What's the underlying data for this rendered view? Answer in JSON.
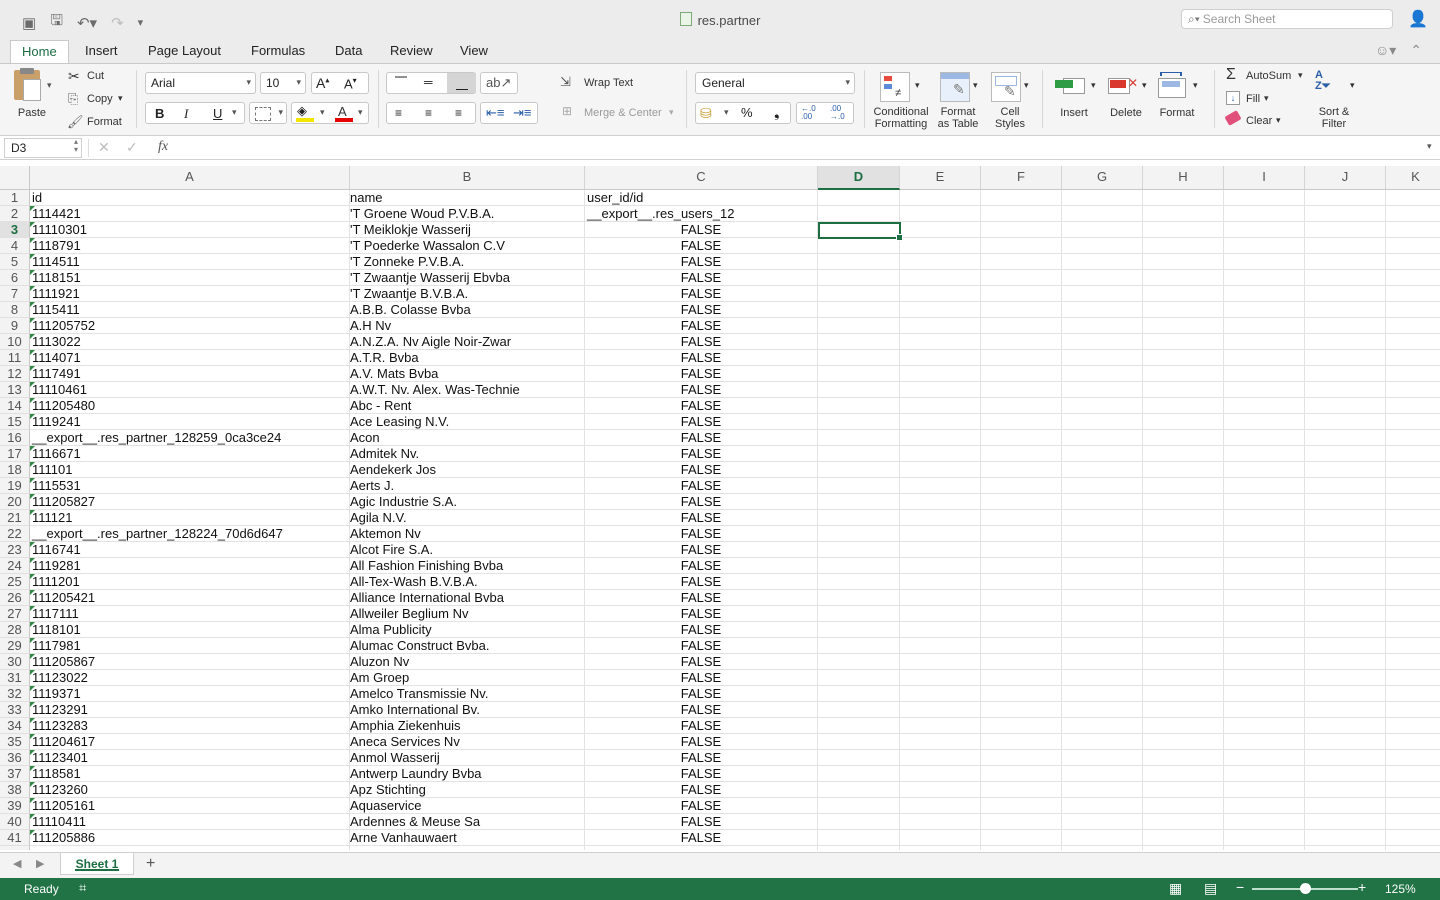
{
  "window": {
    "title": "res.partner",
    "search_placeholder": "Search Sheet"
  },
  "tabs": [
    "Home",
    "Insert",
    "Page Layout",
    "Formulas",
    "Data",
    "Review",
    "View"
  ],
  "ribbon": {
    "paste": "Paste",
    "cut": "Cut",
    "copy": "Copy",
    "format_painter": "Format",
    "font_name": "Arial",
    "font_size": "10",
    "bold": "B",
    "italic": "I",
    "underline": "U",
    "wrap_text": "Wrap Text",
    "merge_center": "Merge & Center",
    "number_format": "General",
    "percent": "%",
    "conditional_formatting": "Conditional\nFormatting",
    "format_as_table": "Format\nas Table",
    "cell_styles": "Cell\nStyles",
    "insert": "Insert",
    "delete": "Delete",
    "format": "Format",
    "autosum": "AutoSum",
    "fill": "Fill",
    "clear": "Clear",
    "sort_filter": "Sort &\nFilter"
  },
  "formula_bar": {
    "name_box": "D3",
    "fx": "fx",
    "formula": ""
  },
  "columns": [
    "A",
    "B",
    "C",
    "D",
    "E",
    "F",
    "G",
    "H",
    "I",
    "J",
    "K"
  ],
  "selected_cell": "D3",
  "rows": [
    {
      "n": "1",
      "a": "id",
      "b": "name",
      "c": "user_id/id",
      "c_left": true,
      "a_num": false
    },
    {
      "n": "2",
      "a": "1114421",
      "b": "'T Groene Woud P.V.B.A.",
      "c": "__export__.res_users_12",
      "c_left": true,
      "a_num": true
    },
    {
      "n": "3",
      "a": "11110301",
      "b": "'T Meiklokje   Wasserij",
      "c": "FALSE",
      "a_num": true
    },
    {
      "n": "4",
      "a": "1118791",
      "b": "'T Poederke   Wassalon C.V",
      "c": "FALSE",
      "a_num": true
    },
    {
      "n": "5",
      "a": "1114511",
      "b": "'T Zonneke P.V.B.A.",
      "c": "FALSE",
      "a_num": true
    },
    {
      "n": "6",
      "a": "1118151",
      "b": "'T Zwaantje  Wasserij  Ebvba",
      "c": "FALSE",
      "a_num": true
    },
    {
      "n": "7",
      "a": "1111921",
      "b": "'T Zwaantje B.V.B.A.",
      "c": "FALSE",
      "a_num": true
    },
    {
      "n": "8",
      "a": "1115411",
      "b": "A.B.B. Colasse Bvba",
      "c": "FALSE",
      "a_num": true
    },
    {
      "n": "9",
      "a": "111205752",
      "b": "A.H Nv",
      "c": "FALSE",
      "a_num": true
    },
    {
      "n": "10",
      "a": "1113022",
      "b": "A.N.Z.A. Nv  Aigle Noir-Zwar",
      "c": "FALSE",
      "a_num": true
    },
    {
      "n": "11",
      "a": "1114071",
      "b": "A.T.R.  Bvba",
      "c": "FALSE",
      "a_num": true
    },
    {
      "n": "12",
      "a": "1117491",
      "b": "A.V. Mats Bvba",
      "c": "FALSE",
      "a_num": true
    },
    {
      "n": "13",
      "a": "11110461",
      "b": "A.W.T. Nv. Alex. Was-Technie",
      "c": "FALSE",
      "a_num": true
    },
    {
      "n": "14",
      "a": "111205480",
      "b": "Abc - Rent",
      "c": "FALSE",
      "a_num": true
    },
    {
      "n": "15",
      "a": "1119241",
      "b": "Ace Leasing N.V.",
      "c": "FALSE",
      "a_num": true
    },
    {
      "n": "16",
      "a": "__export__.res_partner_128259_0ca3ce24",
      "b": "Acon",
      "c": "FALSE",
      "a_num": false
    },
    {
      "n": "17",
      "a": "1116671",
      "b": "Admitek  Nv.",
      "c": "FALSE",
      "a_num": true
    },
    {
      "n": "18",
      "a": "111101",
      "b": "Aendekerk Jos",
      "c": "FALSE",
      "a_num": true
    },
    {
      "n": "19",
      "a": "1115531",
      "b": "Aerts  J.",
      "c": "FALSE",
      "a_num": true
    },
    {
      "n": "20",
      "a": "111205827",
      "b": "Agic Industrie S.A.",
      "c": "FALSE",
      "a_num": true
    },
    {
      "n": "21",
      "a": "111121",
      "b": "Agila  N.V.",
      "c": "FALSE",
      "a_num": true
    },
    {
      "n": "22",
      "a": "__export__.res_partner_128224_70d6d647",
      "b": "Aktemon Nv",
      "c": "FALSE",
      "a_num": false
    },
    {
      "n": "23",
      "a": "1116741",
      "b": "Alcot Fire  S.A.",
      "c": "FALSE",
      "a_num": true
    },
    {
      "n": "24",
      "a": "1119281",
      "b": "All Fashion Finishing Bvba",
      "c": "FALSE",
      "a_num": true
    },
    {
      "n": "25",
      "a": "1111201",
      "b": "All-Tex-Wash B.V.B.A.",
      "c": "FALSE",
      "a_num": true
    },
    {
      "n": "26",
      "a": "111205421",
      "b": "Alliance International Bvba",
      "c": "FALSE",
      "a_num": true
    },
    {
      "n": "27",
      "a": "1117111",
      "b": "Allweiler Beglium Nv",
      "c": "FALSE",
      "a_num": true
    },
    {
      "n": "28",
      "a": "1118101",
      "b": "Alma Publicity",
      "c": "FALSE",
      "a_num": true
    },
    {
      "n": "29",
      "a": "1117981",
      "b": "Alumac Construct Bvba.",
      "c": "FALSE",
      "a_num": true
    },
    {
      "n": "30",
      "a": "111205867",
      "b": "Aluzon Nv",
      "c": "FALSE",
      "a_num": true
    },
    {
      "n": "31",
      "a": "11123022",
      "b": "Am Groep",
      "c": "FALSE",
      "a_num": true
    },
    {
      "n": "32",
      "a": "1119371",
      "b": "Amelco Transmissie Nv.",
      "c": "FALSE",
      "a_num": true
    },
    {
      "n": "33",
      "a": "11123291",
      "b": "Amko  International  Bv.",
      "c": "FALSE",
      "a_num": true
    },
    {
      "n": "34",
      "a": "11123283",
      "b": "Amphia Ziekenhuis",
      "c": "FALSE",
      "a_num": true
    },
    {
      "n": "35",
      "a": "111204617",
      "b": "Aneca Services  Nv",
      "c": "FALSE",
      "a_num": true
    },
    {
      "n": "36",
      "a": "11123401",
      "b": "Anmol   Wasserij",
      "c": "FALSE",
      "a_num": true
    },
    {
      "n": "37",
      "a": "1118581",
      "b": "Antwerp Laundry Bvba",
      "c": "FALSE",
      "a_num": true
    },
    {
      "n": "38",
      "a": "11123260",
      "b": "Apz Stichting",
      "c": "FALSE",
      "a_num": true
    },
    {
      "n": "39",
      "a": "111205161",
      "b": "Aquaservice",
      "c": "FALSE",
      "a_num": true
    },
    {
      "n": "40",
      "a": "11110411",
      "b": "Ardennes &  Meuse Sa",
      "c": "FALSE",
      "a_num": true
    },
    {
      "n": "41",
      "a": "111205886",
      "b": "Arne Vanhauwaert",
      "c": "FALSE",
      "a_num": true
    }
  ],
  "sheet_tabs": [
    "Sheet 1"
  ],
  "status": {
    "ready": "Ready",
    "zoom": "125%"
  },
  "colors": {
    "accent": "#217346",
    "selection": "#1d6f42"
  }
}
